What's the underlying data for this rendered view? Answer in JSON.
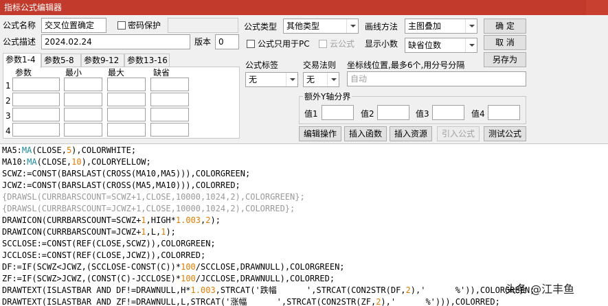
{
  "window": {
    "title": "指标公式编辑器"
  },
  "form": {
    "name_label": "公式名称",
    "name_value": "交叉位置确定",
    "pwd_label": "密码保护",
    "desc_label": "公式描述",
    "desc_value": "2024.02.24",
    "version_label": "版本",
    "version_value": "0",
    "type_label": "公式类型",
    "type_value": "其他类型",
    "draw_label": "画线方法",
    "draw_value": "主图叠加",
    "pc_only_label": "公式只用于PC",
    "cloud_label": "云公式",
    "decimal_label": "显示小数",
    "decimal_value": "缺省位数",
    "tag_label": "公式标签",
    "tag_value": "无",
    "trade_label": "交易法则",
    "trade_value": "无",
    "coord_label": "坐标线位置,最多6个,用分号分隔",
    "coord_placeholder": "自动",
    "yaxis_label": "额外Y轴分界",
    "yvals": [
      "值1",
      "值2",
      "值3",
      "值4"
    ]
  },
  "buttons": {
    "ok": "确  定",
    "cancel": "取  消",
    "saveas": "另存为",
    "edit": "编辑操作",
    "insert_fn": "插入函数",
    "insert_res": "插入资源",
    "import": "引入公式",
    "test": "测试公式"
  },
  "tabs": [
    "参数1-4",
    "参数5-8",
    "参数9-12",
    "参数13-16"
  ],
  "params": {
    "headers": [
      "参数",
      "最小",
      "最大",
      "缺省"
    ],
    "rows": [
      "1",
      "2",
      "3",
      "4"
    ]
  },
  "code_lines": [
    "MA5:MA(CLOSE,5),COLORWHITE;",
    "MA10:MA(CLOSE,10),COLORYELLOW;",
    "SCWZ:=CONST(BARSLAST(CROSS(MA10,MA5))),COLORGREEN;",
    "JCWZ:=CONST(BARSLAST(CROSS(MA5,MA10))),COLORRED;",
    "{DRAWSL(CURRBARSCOUNT=SCWZ+1,CLOSE,10000,1024,2),COLORGREEN};",
    "{DRAWSL(CURRBARSCOUNT=JCWZ+1,CLOSE,10000,1024,2),COLORRED};",
    "DRAWICON(CURRBARSCOUNT=SCWZ+1,HIGH*1.003,2);",
    "DRAWICON(CURRBARSCOUNT=JCWZ+1,L,1);",
    "SCCLOSE:=CONST(REF(CLOSE,SCWZ)),COLORGREEN;",
    "JCCLOSE:=CONST(REF(CLOSE,JCWZ)),COLORRED;",
    "DF:=IF(SCWZ<JCWZ,(SCCLOSE-CONST(C))*100/SCCLOSE,DRAWNULL),COLORGREEN;",
    "ZF:=IF(SCWZ>JCWZ,(CONST(C)-JCCLOSE)*100/JCCLOSE,DRAWNULL),COLORRED;",
    "DRAWTEXT(ISLASTBAR AND DF!=DRAWNULL,H*1.003,STRCAT('跌幅      ',STRCAT(CON2STR(DF,2),'      %')),COLORGREEN;",
    "DRAWTEXT(ISLASTBAR AND ZF!=DRAWNULL,L,STRCAT('涨幅      ',STRCAT(CON2STR(ZF,2),'      %'))),COLORRED;"
  ],
  "watermark": "头条 @江丰鱼",
  "colors": {
    "titlebar": "#c23a2b",
    "code_func": "#1a8a9a",
    "code_num": "#e07b00",
    "code_green": "#00a000",
    "code_dim": "#999999"
  }
}
